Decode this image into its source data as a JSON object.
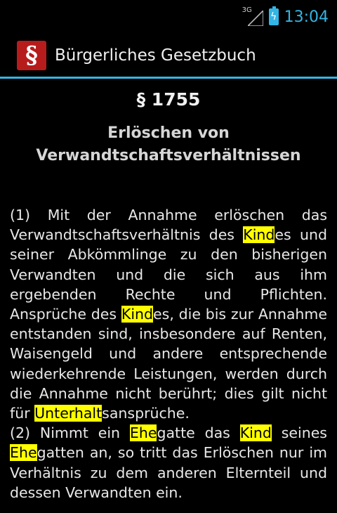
{
  "status": {
    "network": "3G",
    "time": "13:04"
  },
  "header": {
    "logo_letter": "§",
    "title": "Bürgerliches Gesetzbuch"
  },
  "section": {
    "number": "§ 1755",
    "title": "Erlöschen von Verwandtschaftsverhältnissen"
  },
  "paragraphs": [
    [
      {
        "t": "(1) Mit der Annahme erlöschen das Verwandtschaftsverhältnis des "
      },
      {
        "t": "Kind",
        "hl": true
      },
      {
        "t": "es und seiner Abkömmlinge zu den bisherigen Verwandten und die sich aus ihm ergebenden Rechte und Pflichten. Ansprüche des "
      },
      {
        "t": "Kind",
        "hl": true
      },
      {
        "t": "es, die bis zur Annahme entstanden sind, insbesondere auf Renten, Waisengeld und andere entsprechende wiederkehrende Leistungen, werden durch die Annahme nicht berührt; dies gilt nicht für "
      },
      {
        "t": "Unterhalt",
        "hl": true
      },
      {
        "t": "sansprüche."
      }
    ],
    [
      {
        "t": "(2) Nimmt ein "
      },
      {
        "t": "Ehe",
        "hl": true
      },
      {
        "t": "gatte das "
      },
      {
        "t": "Kind",
        "hl": true
      },
      {
        "t": " seines "
      },
      {
        "t": "Ehe",
        "hl": true
      },
      {
        "t": "gatten an, so tritt das Erlöschen nur im Verhältnis zu dem anderen Elternteil und dessen Verwandten ein."
      }
    ]
  ]
}
